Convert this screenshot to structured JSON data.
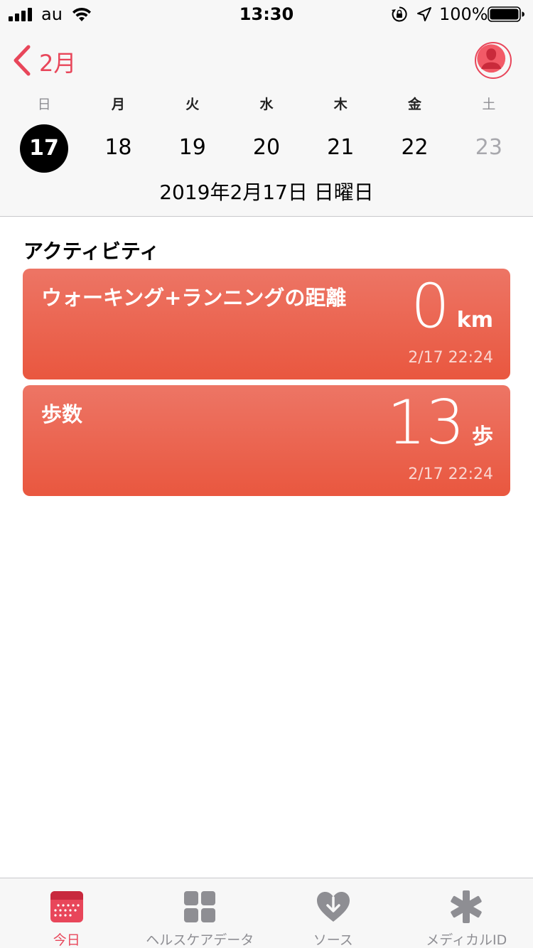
{
  "status_bar": {
    "carrier": "au",
    "time": "13:30",
    "battery_percent": "100%"
  },
  "nav": {
    "back_label": "2月"
  },
  "week": {
    "days": [
      "日",
      "月",
      "火",
      "水",
      "木",
      "金",
      "土"
    ],
    "dates": [
      "17",
      "18",
      "19",
      "20",
      "21",
      "22",
      "23"
    ],
    "selected_index": 0
  },
  "full_date": "2019年2月17日 日曜日",
  "activity": {
    "section_title": "アクティビティ",
    "cards": [
      {
        "title": "ウォーキング+ランニングの距離",
        "value": "0",
        "unit": "km",
        "timestamp": "2/17 22:24"
      },
      {
        "title": "歩数",
        "value": "13",
        "unit": "歩",
        "timestamp": "2/17 22:24"
      }
    ]
  },
  "tabs": [
    {
      "label": "今日",
      "icon": "calendar-today-icon",
      "active": true
    },
    {
      "label": "ヘルスケアデータ",
      "icon": "grid-icon",
      "active": false
    },
    {
      "label": "ソース",
      "icon": "heart-download-icon",
      "active": false
    },
    {
      "label": "メディカルID",
      "icon": "asterisk-icon",
      "active": false
    }
  ],
  "colors": {
    "accent": "#e8465a",
    "card_top": "#ed7565",
    "card_bottom": "#e9573f",
    "tab_inactive": "#8e8e93"
  }
}
